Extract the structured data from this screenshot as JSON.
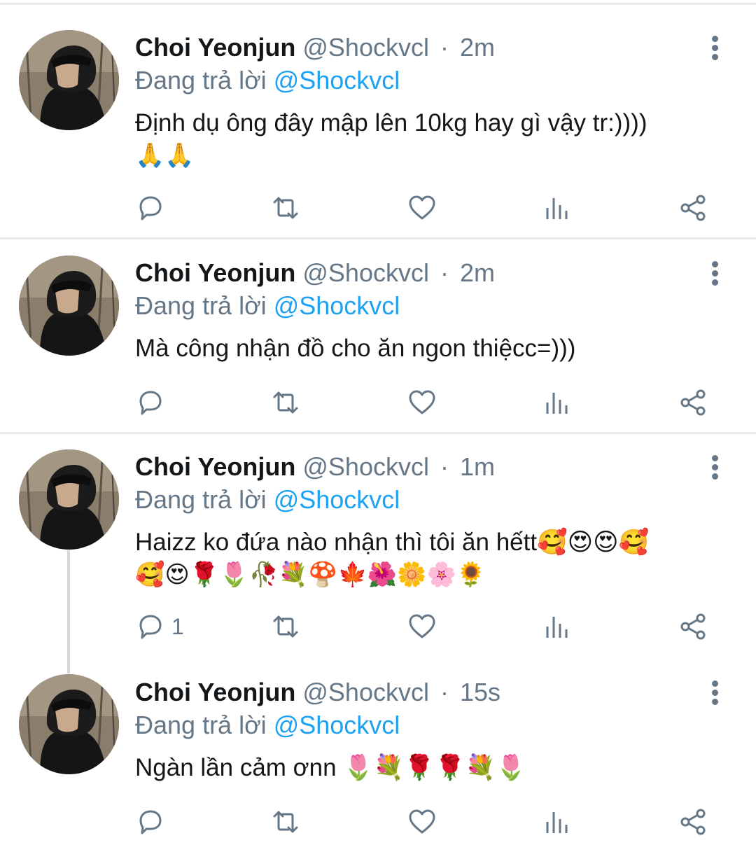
{
  "tweets": [
    {
      "name": "Choi Yeonjun",
      "handle": "@Shockvcl",
      "separator": "·",
      "time": "2m",
      "replying_prefix": "Đang trả lời",
      "replying_to": "@Shockvcl",
      "text_line1": "Định dụ ông đây mập lên 10kg hay gì vậy tr:))))",
      "text_line2": "🙏🙏",
      "reply_count": ""
    },
    {
      "name": "Choi Yeonjun",
      "handle": "@Shockvcl",
      "separator": "·",
      "time": "2m",
      "replying_prefix": "Đang trả lời",
      "replying_to": "@Shockvcl",
      "text_line1": "Mà công nhận đồ cho ăn ngon thiệcc=)))",
      "text_line2": "",
      "reply_count": ""
    },
    {
      "name": "Choi Yeonjun",
      "handle": "@Shockvcl",
      "separator": "·",
      "time": "1m",
      "replying_prefix": "Đang trả lời",
      "replying_to": "@Shockvcl",
      "text_line1": "Haizz ko đứa nào nhận thì tôi ăn hếtt🥰😍😍🥰",
      "text_line2": "🥰😍🌹🌷🥀💐🍄🍁🌺🌼🌸🌻",
      "reply_count": "1"
    },
    {
      "name": "Choi Yeonjun",
      "handle": "@Shockvcl",
      "separator": "·",
      "time": "15s",
      "replying_prefix": "Đang trả lời",
      "replying_to": "@Shockvcl",
      "text_line1": "Ngàn lần cảm ơnn 🌷💐🌹🌹💐🌷",
      "text_line2": "",
      "reply_count": ""
    }
  ],
  "icons": {
    "reply": "reply-icon",
    "retweet": "retweet-icon",
    "like": "heart-icon",
    "analytics": "analytics-icon",
    "share": "share-icon",
    "more": "more-vertical-icon"
  },
  "colors": {
    "name": "#14171a",
    "secondary": "#657786",
    "mention": "#1da1f2",
    "separator": "#e8ecef",
    "thread_line": "#d3d9de"
  }
}
